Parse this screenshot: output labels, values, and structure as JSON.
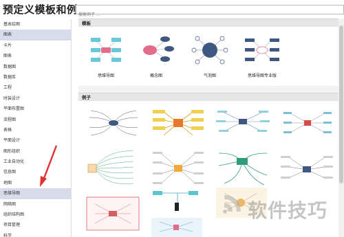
{
  "page_title": "预定义模板和例子",
  "search": {
    "placeholder": "搜索例子 ..."
  },
  "sidebar": {
    "items": [
      {
        "label": "基本绘图",
        "selected": false
      },
      {
        "label": "图表",
        "selected": true
      },
      {
        "label": "卡片",
        "selected": false
      },
      {
        "label": "图表",
        "selected": false
      },
      {
        "label": "数据图",
        "selected": false
      },
      {
        "label": "数据库",
        "selected": false
      },
      {
        "label": "工程",
        "selected": false
      },
      {
        "label": "时装设计",
        "selected": false
      },
      {
        "label": "平面布置图",
        "selected": false
      },
      {
        "label": "流程图",
        "selected": false
      },
      {
        "label": "表格",
        "selected": false
      },
      {
        "label": "平面设计",
        "selected": false
      },
      {
        "label": "图形组织",
        "selected": false
      },
      {
        "label": "工业自动化",
        "selected": false
      },
      {
        "label": "信息图",
        "selected": false
      },
      {
        "label": "地图",
        "selected": false
      },
      {
        "label": "思维导图",
        "selected": true
      },
      {
        "label": "网络图",
        "selected": false
      },
      {
        "label": "组织结构图",
        "selected": false
      },
      {
        "label": "项目管理",
        "selected": false
      },
      {
        "label": "科学",
        "selected": false
      }
    ]
  },
  "sections": {
    "basic": "模板",
    "examples": "例子"
  },
  "templates": [
    {
      "label": "思维导图",
      "icon": "mindmap-template-icon"
    },
    {
      "label": "概念图",
      "icon": "concept-map-template-icon"
    },
    {
      "label": "气泡图",
      "icon": "bubble-map-template-icon"
    },
    {
      "label": "思维导图专业版",
      "icon": "mindmap-pro-template-icon"
    }
  ],
  "colors": {
    "cyan": "#66c8d8",
    "pink": "#e26c8a",
    "navy": "#3f5882",
    "selected": "#d8dcea",
    "header": "#e6e6e6"
  },
  "watermark": "软件技巧"
}
